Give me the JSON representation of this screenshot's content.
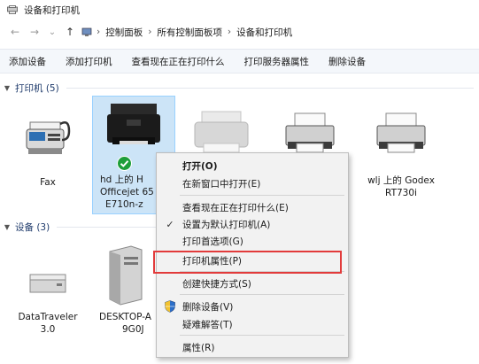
{
  "window": {
    "title": "设备和打印机",
    "icon": "devices-printers-icon"
  },
  "nav": {
    "back": "←",
    "forward": "→",
    "dropdown": "⌄",
    "up": "↑",
    "breadcrumb": [
      "控制面板",
      "所有控制面板项",
      "设备和打印机"
    ],
    "separator": "›"
  },
  "toolbar": {
    "items": [
      "添加设备",
      "添加打印机",
      "查看现在正在打印什么",
      "打印服务器属性",
      "删除设备"
    ]
  },
  "printers": {
    "header": "打印机 (5)",
    "items": [
      {
        "label": "Fax",
        "icon": "fax-icon"
      },
      {
        "label": "hd 上的 HP Officejet 65 E710n-z",
        "label_lines": [
          "hd 上的 H",
          "Officejet 65",
          "E710n-z"
        ],
        "icon": "hp-officejet-printer-icon",
        "selected": true,
        "default": true
      },
      {
        "label": "",
        "icon": "printer-icon"
      },
      {
        "label": "",
        "icon": "printer-icon"
      },
      {
        "label": "wlj 上的 Godex RT730i",
        "label_lines": [
          "wlj 上的 Godex",
          "RT730i"
        ],
        "icon": "label-printer-icon"
      }
    ]
  },
  "devices": {
    "header": "设备 (3)",
    "items": [
      {
        "label_lines": [
          "DataTraveler",
          "3.0"
        ],
        "icon": "usb-drive-icon"
      },
      {
        "label_lines": [
          "DESKTOP-A",
          "9G0J"
        ],
        "icon": "desktop-tower-icon"
      }
    ]
  },
  "context_menu": {
    "items": [
      {
        "label": "打开(O)",
        "bold": true
      },
      {
        "label": "在新窗口中打开(E)"
      },
      {
        "label": "查看现在正在打印什么(E)"
      },
      {
        "label": "设置为默认打印机(A)",
        "lead": "✓"
      },
      {
        "label": "打印首选项(G)"
      },
      {
        "label": "打印机属性(P)",
        "highlighted": true
      },
      {
        "label": "创建快捷方式(S)"
      },
      {
        "label": "删除设备(V)",
        "lead_icon": "shield-icon"
      },
      {
        "label": "疑难解答(T)"
      },
      {
        "label": "属性(R)"
      }
    ]
  },
  "colors": {
    "highlight_box": "#e23b3b",
    "selection_fill": "#cce4f7",
    "check_green": "#1e9e3a",
    "section_text": "#1e3a6b"
  }
}
